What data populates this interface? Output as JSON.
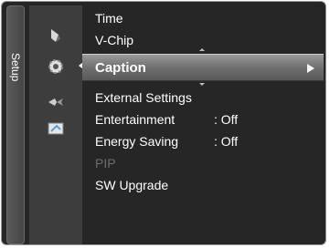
{
  "side_tab": {
    "label": "Setup"
  },
  "icons": {
    "picture": "picture-icon",
    "setup": "gear-icon",
    "sound": "satellite-icon",
    "input": "input-icon"
  },
  "menu": {
    "items": [
      {
        "label": "Time",
        "value": "",
        "state": "normal"
      },
      {
        "label": "V-Chip",
        "value": "",
        "state": "normal"
      },
      {
        "label": "Caption",
        "value": "",
        "state": "selected"
      },
      {
        "label": "External Settings",
        "value": "",
        "state": "normal"
      },
      {
        "label": "Entertainment",
        "value": ": Off",
        "state": "normal"
      },
      {
        "label": "Energy Saving",
        "value": ": Off",
        "state": "normal"
      },
      {
        "label": "PIP",
        "value": "",
        "state": "disabled"
      },
      {
        "label": "SW Upgrade",
        "value": "",
        "state": "normal"
      }
    ]
  },
  "colors": {
    "background": "#262626",
    "highlight": "#8a8a8a",
    "text": "#ffffff",
    "disabled_text": "#6d6d6d"
  }
}
